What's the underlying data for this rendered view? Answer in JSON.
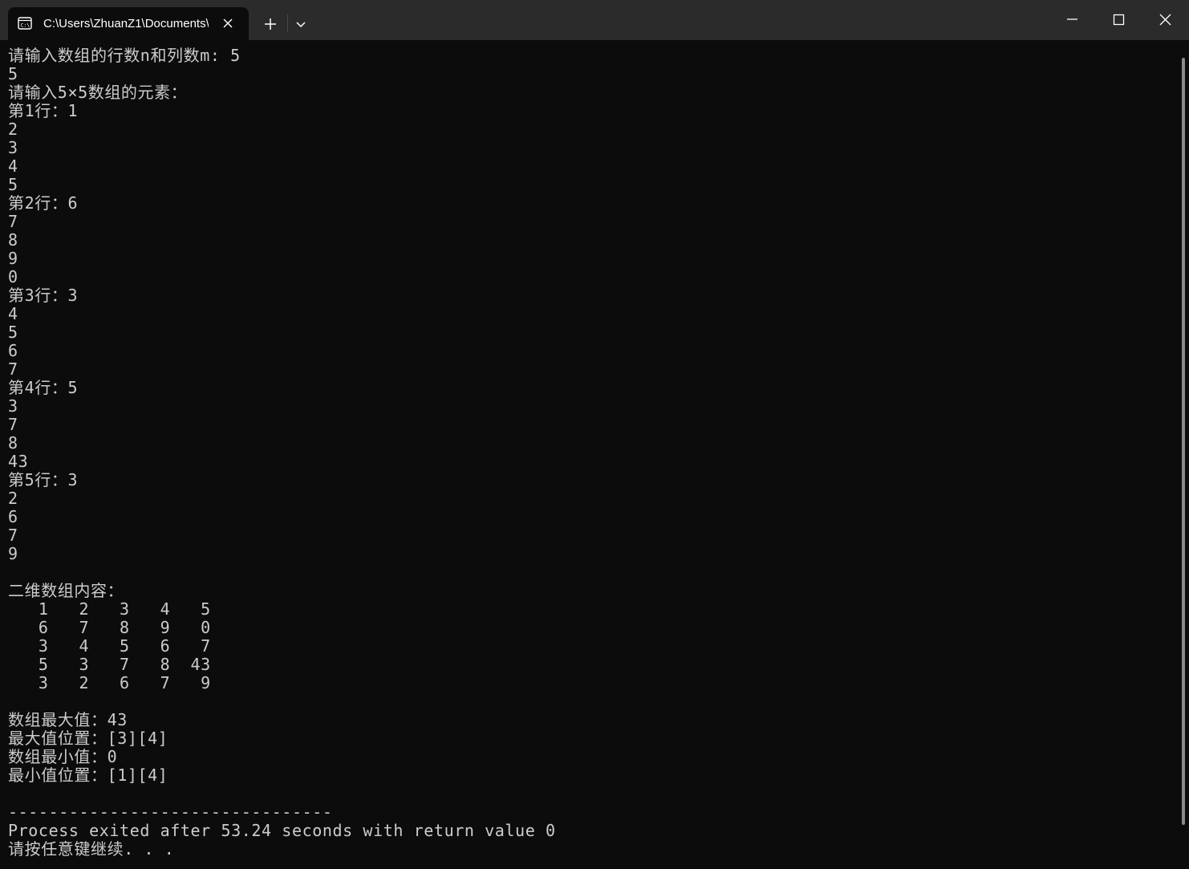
{
  "window": {
    "tab_title": "C:\\Users\\ZhuanZ1\\Documents\\",
    "tab_icon": "terminal-icon",
    "controls": [
      "new-tab",
      "dropdown",
      "minimize",
      "maximize",
      "close"
    ]
  },
  "console": {
    "lines": [
      "请输入数组的行数n和列数m: 5",
      "5",
      "请输入5×5数组的元素：",
      "第1行：1",
      "2",
      "3",
      "4",
      "5",
      "第2行：6",
      "7",
      "8",
      "9",
      "0",
      "第3行：3",
      "4",
      "5",
      "6",
      "7",
      "第4行：5",
      "3",
      "7",
      "8",
      "43",
      "第5行：3",
      "2",
      "6",
      "7",
      "9",
      "",
      "二维数组内容：",
      "   1   2   3   4   5",
      "   6   7   8   9   0",
      "   3   4   5   6   7",
      "   5   3   7   8  43",
      "   3   2   6   7   9",
      "",
      "数组最大值：43",
      "最大值位置：[3][4]",
      "数组最小值：0",
      "最小值位置：[1][4]",
      "",
      "--------------------------------",
      "Process exited after 53.24 seconds with return value 0",
      "请按任意键继续. . ."
    ]
  },
  "colors": {
    "background": "#0c0c0c",
    "titlebar": "#2b2b2b",
    "text": "#cccccc"
  }
}
